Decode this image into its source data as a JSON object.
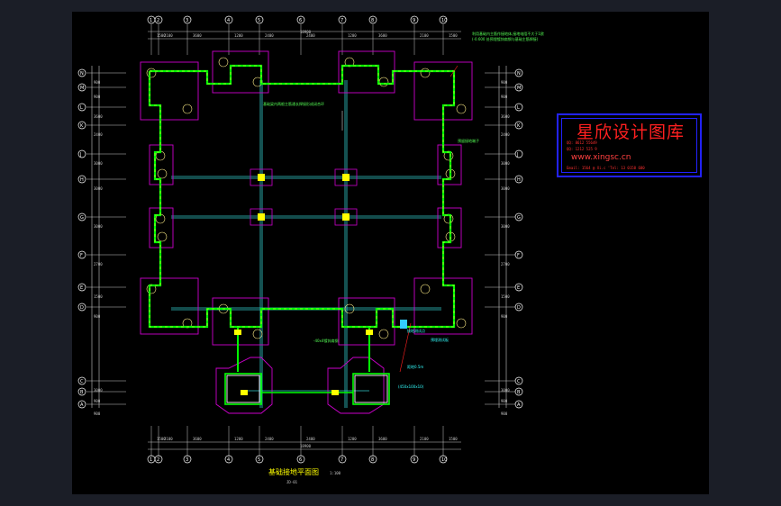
{
  "drawing": {
    "plan_title": "基础接地平面图",
    "plan_scale": "1:100",
    "plan_subtitle": "JD-01",
    "top_overall_dim": "18900",
    "bottom_overall_dim": "18900",
    "top_axes": [
      "1",
      "2",
      "3",
      "4",
      "5",
      "6",
      "7",
      "8",
      "9",
      "10"
    ],
    "bottom_axes": [
      "1",
      "2",
      "3",
      "4",
      "5",
      "6",
      "7",
      "8",
      "9",
      "10"
    ],
    "left_axes": [
      "N",
      "M",
      "L",
      "K",
      "J",
      "H",
      "G",
      "F",
      "E",
      "D",
      "C",
      "B",
      "A"
    ],
    "top_dims": [
      "1500",
      "2100",
      "3600",
      "1200",
      "2400",
      "2400",
      "1200",
      "3600",
      "2100",
      "1500"
    ],
    "bottom_dims": [
      "1500",
      "2100",
      "3600",
      "1200",
      "2400",
      "2400",
      "1200",
      "3600",
      "2100",
      "1500"
    ],
    "left_dims": [
      "900",
      "900",
      "3600",
      "2400",
      "3000",
      "3000",
      "3000",
      "2700",
      "1500",
      "900",
      "3000",
      "900",
      "900"
    ],
    "right_dims": [
      "900",
      "900",
      "3600",
      "2400",
      "3000",
      "3000",
      "3000",
      "2700",
      "1500",
      "900",
      "3000",
      "900",
      "900"
    ],
    "notes": {
      "note_top_right": "利用基础内主筋作接地体,接地电阻不大于1欧",
      "note_top_right_2": "(-0.600 处预埋镀锌扁钢与基础主筋焊接)",
      "note_center": "基础梁内两根主筋通长焊接形成闭合环",
      "note_right_mid": "预留接地端子",
      "note_bottom_center": "-40x4镀锌扁钢",
      "note_bottom_right_1": "接地测试点",
      "note_bottom_right_2": "预埋测试板",
      "note_bottom_right_3": "距地0.5m",
      "note_bottom_right_4": "(450x100x10)"
    }
  },
  "watermark": {
    "title": "星欣设计图库",
    "line1": "QQ: 8612 55649",
    "line2": "QQ: 1212 525 9",
    "url": "www.xingsc.cn",
    "mail": "Email: 1564 @ Xi.c 'Tel: 13 0158 680"
  },
  "colors": {
    "background": "#000000",
    "chrome": "#1b1e27",
    "dimension": "#c8c8c8",
    "axis_line": "#ffffff",
    "foundation_outline": "#cc00cc",
    "grounding_bar": "#00ff00",
    "grid_beam": "#33cccc",
    "column": "#ffff00",
    "leader": "#ff2020",
    "watermark_border": "#2222ff",
    "watermark_text": "#ff2020"
  }
}
